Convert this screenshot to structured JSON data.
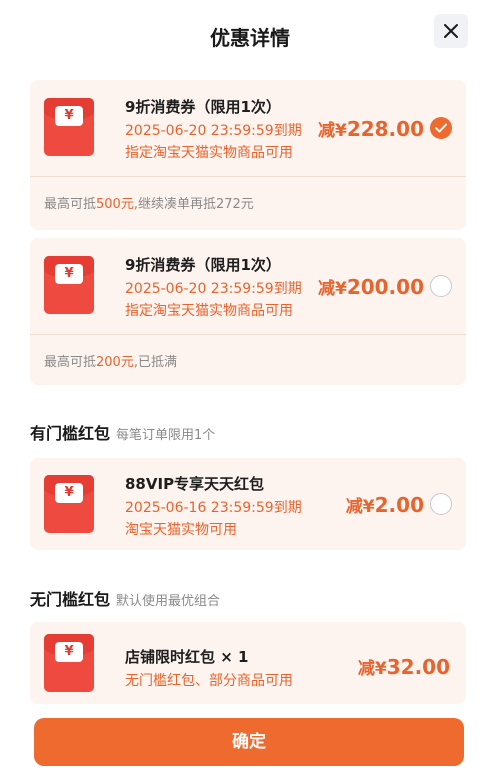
{
  "header": {
    "title": "优惠详情",
    "close_icon": "close-icon"
  },
  "coupons": [
    {
      "title": "9折消费券（限用1次）",
      "expiry": "2025-06-20 23:59:59到期",
      "scope": "指定淘宝天猫实物商品可用",
      "amount_prefix": "减¥",
      "amount": "228.00",
      "selected": true,
      "footer_prefix": "最高可抵",
      "footer_highlight": "500元",
      "footer_suffix": ",继续凑单再抵272元"
    },
    {
      "title": "9折消费券（限用1次）",
      "expiry": "2025-06-20 23:59:59到期",
      "scope": "指定淘宝天猫实物商品可用",
      "amount_prefix": "减¥",
      "amount": "200.00",
      "selected": false,
      "footer_prefix": "最高可抵",
      "footer_highlight": "200元",
      "footer_suffix": ",已抵满"
    }
  ],
  "threshold_section": {
    "title": "有门槛红包",
    "subtitle": "每笔订单限用1个"
  },
  "threshold_packet": {
    "title": "88VIP专享天天红包",
    "expiry": "2025-06-16 23:59:59到期",
    "scope": "淘宝天猫实物可用",
    "amount_prefix": "减¥",
    "amount": "2.00",
    "selected": false
  },
  "no_threshold_section": {
    "title": "无门槛红包",
    "subtitle": "默认使用最优组合"
  },
  "no_threshold_packet": {
    "title": "店铺限时红包 × 1",
    "scope": "无门槛红包、部分商品可用",
    "amount_prefix": "减¥",
    "amount": "32.00"
  },
  "envelope_glyph": "¥",
  "confirm_label": "确定",
  "colors": {
    "accent": "#ee6a2e",
    "envelope": "#ee4a40",
    "card_bg": "#fdf3ef"
  }
}
